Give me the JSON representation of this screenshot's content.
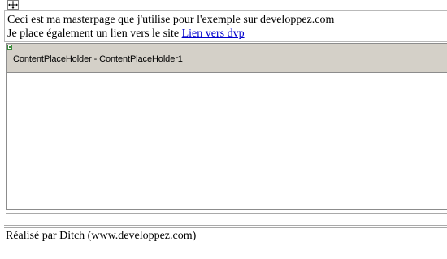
{
  "header": {
    "line1": "Ceci est ma masterpage que j'utilise pour l'exemple sur developpez.com",
    "line2_prefix": "Je place également un lien vers le site ",
    "link_text": "Lien vers dvp"
  },
  "content_placeholder": {
    "title": "ContentPlaceHolder - ContentPlaceHolder1"
  },
  "footer": {
    "text": "Réalisé par Ditch (www.developpez.com)"
  },
  "icons": {
    "move_handle": "move-arrows-icon",
    "placeholder_tag": "placeholder-tag-icon"
  },
  "colors": {
    "link": "#0000cc",
    "placeholder_bar": "#d4d0c8",
    "tag_green": "#3a8a3a"
  }
}
